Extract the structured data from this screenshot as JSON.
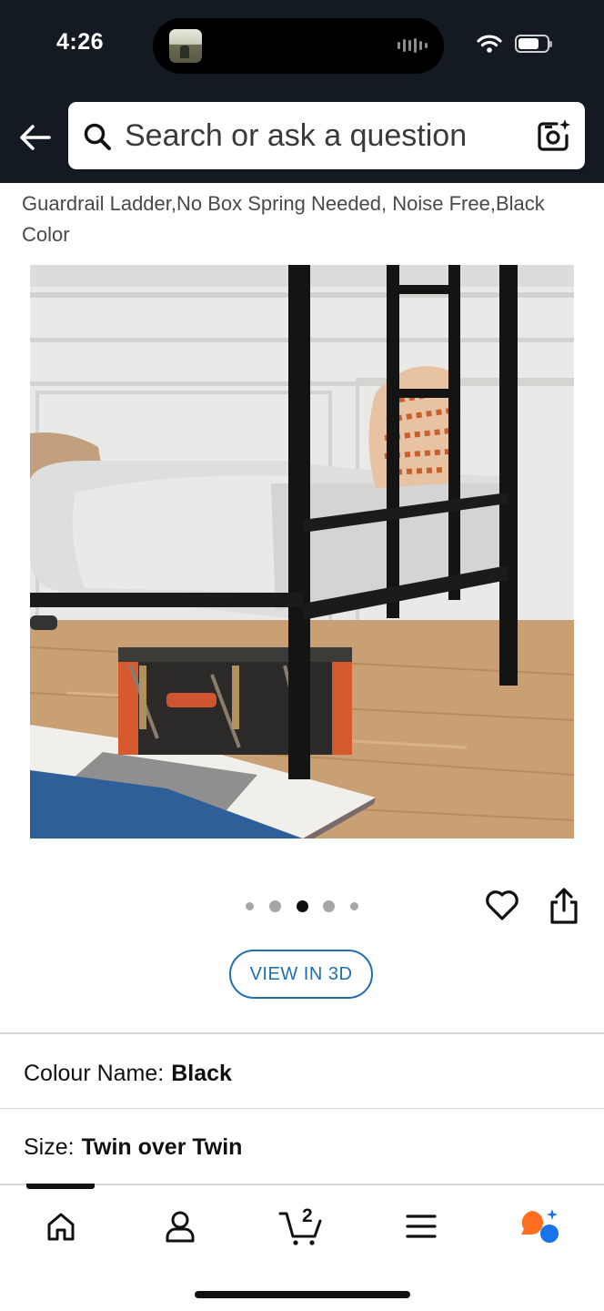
{
  "status_bar": {
    "time": "4:26",
    "icons": [
      "music-thumbnail-icon",
      "audio-wave-icon",
      "wifi-icon",
      "battery-icon"
    ]
  },
  "search": {
    "placeholder": "Search or ask a question",
    "icons": [
      "back-arrow-icon",
      "search-icon",
      "camera-search-icon"
    ]
  },
  "product": {
    "title": "Guardrail Ladder,No Box Spring Needed, Noise Free,Black Color",
    "image_description_icons": [
      "product-photo"
    ],
    "carousel": {
      "count": 5,
      "active_index": 2
    },
    "actions": [
      "heart-icon",
      "share-icon"
    ],
    "view3d_label": "VIEW IN 3D"
  },
  "variants": {
    "colour_label": "Colour Name:",
    "colour_value": "Black",
    "size_label": "Size:",
    "size_value": "Twin over Twin"
  },
  "bottom_nav": {
    "items": [
      "home-icon",
      "account-icon",
      "cart-icon",
      "menu-icon",
      "rufus-icon"
    ],
    "cart_count": "2",
    "active_index": 0
  },
  "colors": {
    "header_bg": "#131a22",
    "link_blue": "#1f6fae",
    "rufus_orange": "#ff6d1f",
    "rufus_blue": "#1a73e8"
  }
}
